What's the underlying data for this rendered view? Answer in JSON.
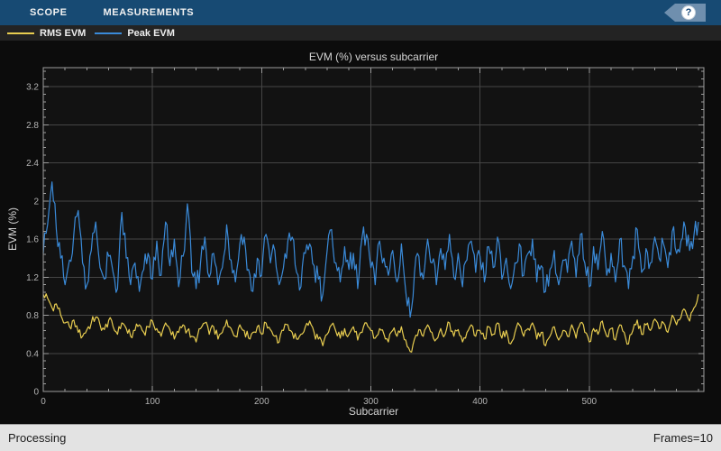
{
  "toolbar": {
    "tabs": [
      {
        "label": "SCOPE"
      },
      {
        "label": "MEASUREMENTS"
      }
    ],
    "help_icon": "?"
  },
  "legend": {
    "items": [
      {
        "label": "RMS EVM",
        "color": "#e8cd50"
      },
      {
        "label": "Peak EVM",
        "color": "#3a8ad8"
      }
    ]
  },
  "status": {
    "left": "Processing",
    "right": "Frames=10"
  },
  "chart_data": {
    "type": "line",
    "title": "EVM (%) versus subcarrier",
    "xlabel": "Subcarrier",
    "ylabel": "EVM (%)",
    "xlim": [
      0,
      605
    ],
    "ylim": [
      0,
      3.4
    ],
    "x_major_ticks": [
      0,
      100,
      200,
      300,
      400,
      500
    ],
    "x_minor_step": 20,
    "y_major_ticks": [
      0,
      0.4,
      0.8,
      1.2,
      1.6,
      2,
      2.4,
      2.8,
      3.2
    ],
    "y_minor_step": 0.08,
    "grid": true,
    "legend_position": "top-strip",
    "colors": {
      "plot_bg": "#121212",
      "outer_bg": "#0c0c0c",
      "frame": "#9d9d9d",
      "gridline": "#454545",
      "tick_label": "#b4b4b4"
    },
    "x_start": 0,
    "x_step": 4,
    "series": [
      {
        "name": "RMS EVM",
        "color": "#e8cd50",
        "noise": 0.05,
        "values": [
          1.02,
          0.98,
          0.88,
          0.92,
          0.8,
          0.72,
          0.68,
          0.75,
          0.62,
          0.58,
          0.65,
          0.72,
          0.78,
          0.7,
          0.65,
          0.75,
          0.68,
          0.6,
          0.72,
          0.66,
          0.58,
          0.64,
          0.7,
          0.62,
          0.68,
          0.74,
          0.66,
          0.58,
          0.72,
          0.65,
          0.55,
          0.62,
          0.7,
          0.64,
          0.58,
          0.52,
          0.66,
          0.72,
          0.6,
          0.68,
          0.55,
          0.62,
          0.75,
          0.66,
          0.58,
          0.7,
          0.64,
          0.56,
          0.62,
          0.68,
          0.6,
          0.72,
          0.65,
          0.58,
          0.52,
          0.64,
          0.7,
          0.62,
          0.55,
          0.6,
          0.68,
          0.74,
          0.62,
          0.55,
          0.48,
          0.6,
          0.7,
          0.63,
          0.56,
          0.66,
          0.6,
          0.68,
          0.54,
          0.62,
          0.72,
          0.64,
          0.56,
          0.66,
          0.6,
          0.52,
          0.64,
          0.58,
          0.68,
          0.54,
          0.42,
          0.55,
          0.65,
          0.58,
          0.7,
          0.62,
          0.55,
          0.66,
          0.6,
          0.72,
          0.58,
          0.65,
          0.52,
          0.62,
          0.7,
          0.58,
          0.64,
          0.55,
          0.68,
          0.6,
          0.72,
          0.56,
          0.64,
          0.5,
          0.62,
          0.7,
          0.58,
          0.66,
          0.72,
          0.55,
          0.62,
          0.48,
          0.58,
          0.68,
          0.54,
          0.64,
          0.58,
          0.7,
          0.56,
          0.72,
          0.62,
          0.52,
          0.66,
          0.6,
          0.74,
          0.58,
          0.66,
          0.54,
          0.7,
          0.62,
          0.5,
          0.64,
          0.75,
          0.6,
          0.7,
          0.64,
          0.76,
          0.66,
          0.72,
          0.62,
          0.8,
          0.7,
          0.78,
          0.85,
          0.74,
          0.88,
          1.02
        ]
      },
      {
        "name": "Peak EVM",
        "color": "#3a8ad8",
        "noise": 0.13,
        "values": [
          1.45,
          1.75,
          2.2,
          1.7,
          1.4,
          1.12,
          1.38,
          1.65,
          1.9,
          1.35,
          1.12,
          1.48,
          1.78,
          1.3,
          1.18,
          1.42,
          1.25,
          1.08,
          1.88,
          1.4,
          1.12,
          1.35,
          1.05,
          1.28,
          1.45,
          1.18,
          1.58,
          1.22,
          1.78,
          1.32,
          1.6,
          1.1,
          1.42,
          1.97,
          1.25,
          1.08,
          1.35,
          1.62,
          1.2,
          1.45,
          1.12,
          1.3,
          1.75,
          1.38,
          1.15,
          1.55,
          1.62,
          1.28,
          1.05,
          1.4,
          1.22,
          1.65,
          1.35,
          1.48,
          1.12,
          1.3,
          1.58,
          1.62,
          1.25,
          1.1,
          1.45,
          1.55,
          1.32,
          1.18,
          1.02,
          1.48,
          1.7,
          1.35,
          1.15,
          1.52,
          1.28,
          1.45,
          1.08,
          1.62,
          1.65,
          1.3,
          1.12,
          1.58,
          1.4,
          1.22,
          1.48,
          1.15,
          1.55,
          1.05,
          0.78,
          1.25,
          1.42,
          1.18,
          1.6,
          1.35,
          1.12,
          1.5,
          1.28,
          1.65,
          1.2,
          1.45,
          1.1,
          1.38,
          1.58,
          1.25,
          1.42,
          1.15,
          1.52,
          1.3,
          1.62,
          1.18,
          1.4,
          1.08,
          1.35,
          1.55,
          1.22,
          1.45,
          1.6,
          1.15,
          1.32,
          1.05,
          1.28,
          1.48,
          1.12,
          1.38,
          1.25,
          1.58,
          1.2,
          1.65,
          1.35,
          1.1,
          1.52,
          1.28,
          1.68,
          1.22,
          1.45,
          1.15,
          1.6,
          1.32,
          1.08,
          1.42,
          1.7,
          1.25,
          1.5,
          1.35,
          1.62,
          1.4,
          1.55,
          1.3,
          1.68,
          1.45,
          1.58,
          1.72,
          1.48,
          1.65,
          1.78
        ]
      }
    ]
  }
}
